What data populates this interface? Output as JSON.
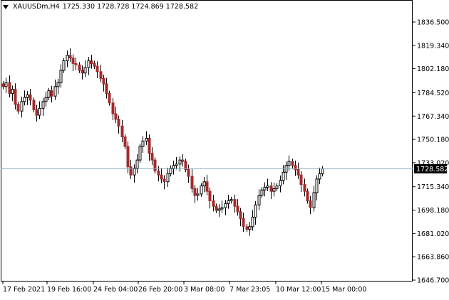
{
  "header": {
    "symbol": "XAUUSDm,H4",
    "ohlc": "1725.330 1728.728 1724.869 1728.582"
  },
  "price_axis": {
    "labels": [
      "1836.500",
      "1819.340",
      "1802.180",
      "1784.520",
      "1767.340",
      "1750.180",
      "1733.020",
      "1715.340",
      "1698.180",
      "1681.020",
      "1663.860",
      "1646.700"
    ],
    "current_price": "1728.582"
  },
  "time_axis": {
    "labels": [
      "17 Feb 2021",
      "19 Feb 16:00",
      "24 Feb 04:00",
      "26 Feb 20:00",
      "3 Mar 08:00",
      "7 Mar 23:05",
      "10 Mar 12:00",
      "15 Mar 00:00"
    ]
  },
  "colors": {
    "bull": "#000000",
    "bear": "#a52a2a",
    "candle_body_up": "#ffffff",
    "price_line": "#8aa9b4",
    "axis": "#000000"
  },
  "chart_data": {
    "type": "candlestick",
    "symbol": "XAUUSDm",
    "timeframe": "H4",
    "ylim": [
      1646.7,
      1836.5
    ],
    "xlabels": [
      "17 Feb 2021",
      "19 Feb 16:00",
      "24 Feb 04:00",
      "26 Feb 20:00",
      "3 Mar 08:00",
      "7 Mar 23:05",
      "10 Mar 12:00",
      "15 Mar 00:00"
    ],
    "current_price": 1728.582,
    "closes": [
      1789,
      1792,
      1784,
      1787,
      1776,
      1771,
      1778,
      1781,
      1783,
      1779,
      1772,
      1768,
      1773,
      1778,
      1781,
      1786,
      1782,
      1789,
      1792,
      1801,
      1808,
      1812,
      1810,
      1806,
      1805,
      1801,
      1799,
      1803,
      1808,
      1806,
      1804,
      1800,
      1795,
      1791,
      1784,
      1777,
      1769,
      1765,
      1760,
      1752,
      1745,
      1730,
      1724,
      1729,
      1735,
      1745,
      1749,
      1751,
      1740,
      1735,
      1727,
      1724,
      1721,
      1719,
      1725,
      1729,
      1731,
      1732,
      1735,
      1734,
      1728,
      1723,
      1714,
      1709,
      1710,
      1716,
      1719,
      1712,
      1705,
      1701,
      1698,
      1699,
      1700,
      1703,
      1705,
      1706,
      1701,
      1697,
      1692,
      1686,
      1684,
      1686,
      1693,
      1702,
      1709,
      1713,
      1715,
      1716,
      1712,
      1714,
      1716,
      1720,
      1726,
      1731,
      1734,
      1731,
      1728,
      1724,
      1717,
      1712,
      1705,
      1700,
      1711,
      1721,
      1725,
      1728.58
    ]
  }
}
